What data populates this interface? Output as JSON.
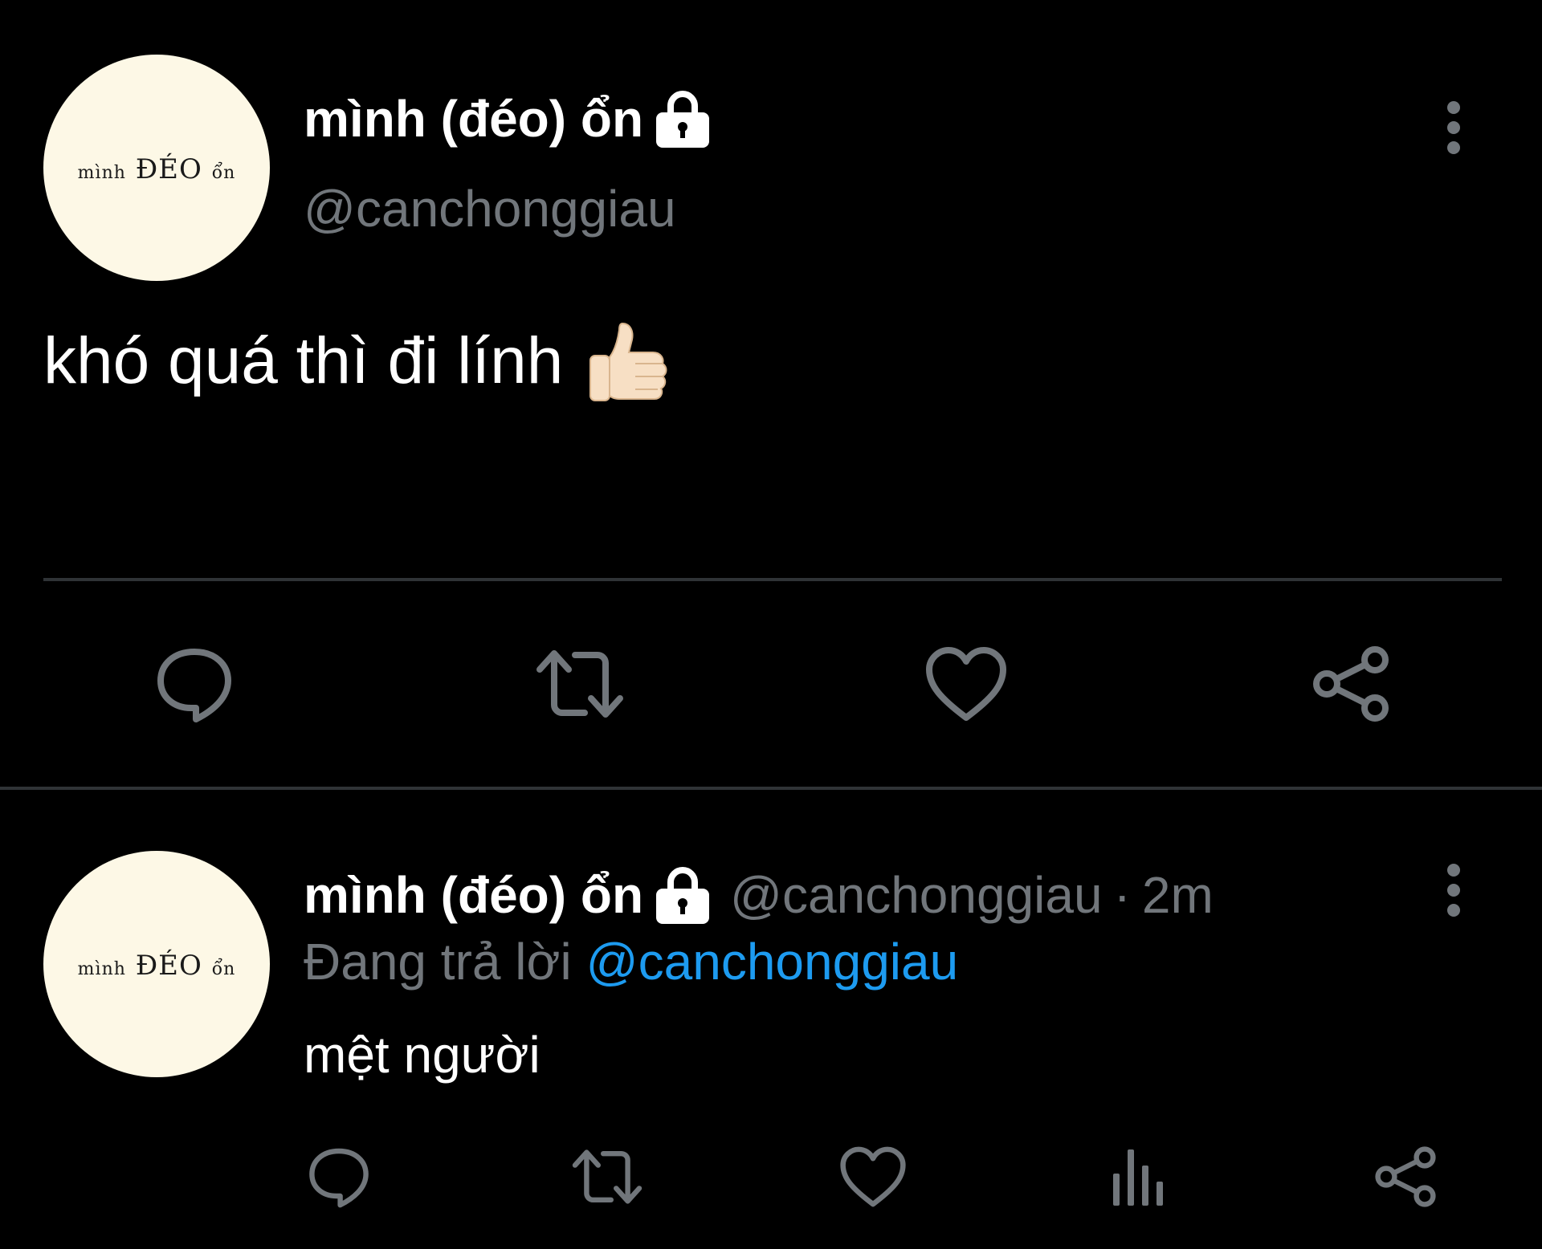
{
  "main_tweet": {
    "avatar_text": {
      "part1": "mình",
      "part2": "ĐÉO",
      "part3": "ổn"
    },
    "display_name": "mình (đéo) ổn",
    "handle": "@canchonggiau",
    "text": "khó quá thì đi lính",
    "emoji_icon": "thumbs-up-light-skin",
    "actions": [
      "reply-icon",
      "retweet-icon",
      "like-icon",
      "share-icon"
    ]
  },
  "reply_tweet": {
    "avatar_text": {
      "part1": "mình",
      "part2": "ĐÉO",
      "part3": "ổn"
    },
    "display_name": "mình (đéo) ổn",
    "handle": "@canchonggiau",
    "separator": "·",
    "time": "2m",
    "replying_prefix": "Đang trả lời",
    "replying_to": "@canchonggiau",
    "text": "mệt người",
    "actions": [
      "reply-icon",
      "retweet-icon",
      "like-icon",
      "analytics-icon",
      "share-icon"
    ]
  },
  "colors": {
    "background": "#000000",
    "text_primary": "#ffffff",
    "text_secondary": "#71767b",
    "accent_link": "#1d9bf0",
    "divider": "#2f3336",
    "avatar_bg": "#fdf8e6"
  }
}
